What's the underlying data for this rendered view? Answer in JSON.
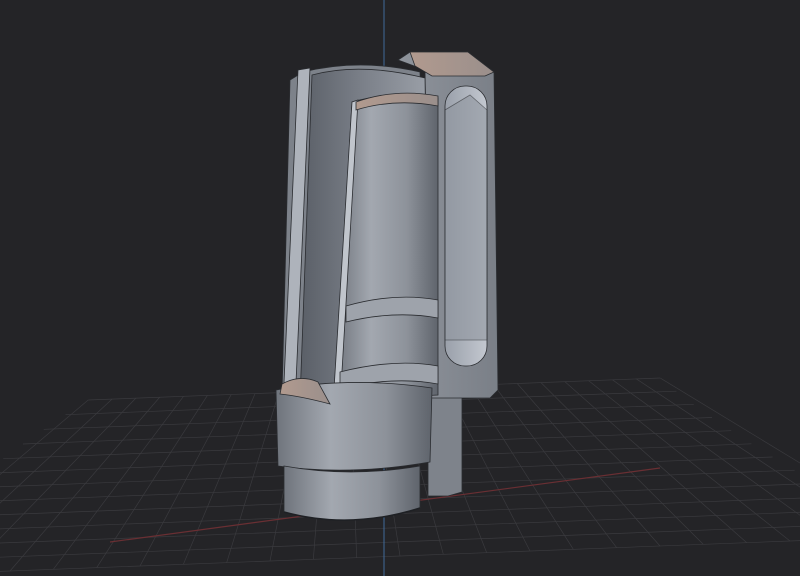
{
  "viewport": {
    "background_color": "#242427",
    "grid_color": "#3a3a3e",
    "x_axis_color": "#6a2f33",
    "z_axis_color": "#3f6a9a",
    "model_color": "#8a8f98",
    "model_highlight_color": "#b9bec6",
    "model_cut_color": "#a89088"
  }
}
